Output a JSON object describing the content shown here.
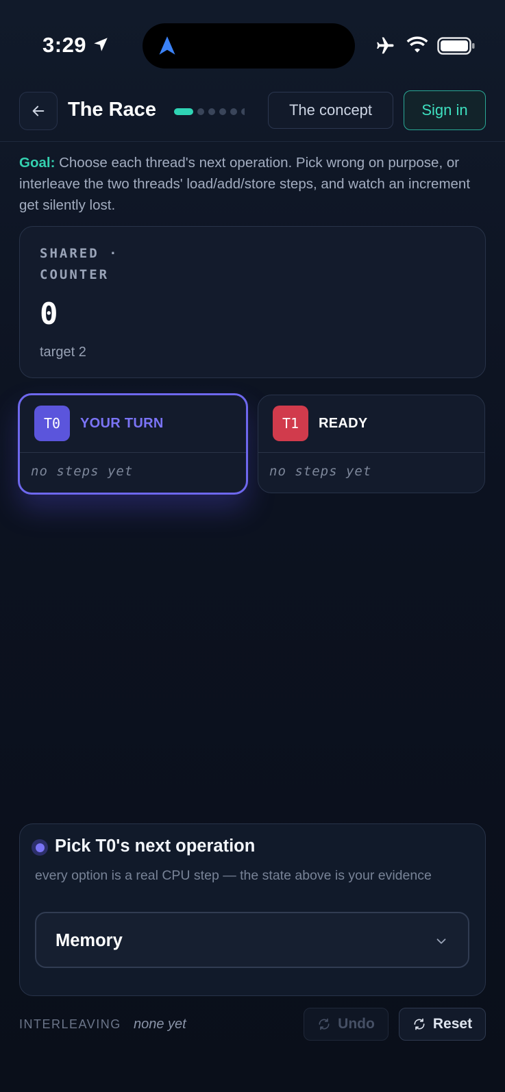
{
  "status_bar": {
    "time": "3:29",
    "icons": [
      "location-arrow-icon",
      "navigation-icon",
      "airplane-icon",
      "wifi-icon",
      "battery-icon"
    ]
  },
  "header": {
    "title": "The Race",
    "concept_label": "The concept",
    "signin_label": "Sign in",
    "progress_step": 1,
    "progress_total": 6
  },
  "goal": {
    "label": "Goal:",
    "text": " Choose each thread's next operation. Pick wrong on purpose, or interleave the two threads' load/add/store steps, and watch an increment get silently lost."
  },
  "counter": {
    "label": "SHARED · COUNTER",
    "value": "0",
    "target": "target 2"
  },
  "threads": [
    {
      "id": "T0",
      "status": "YOUR TURN",
      "steps": "no steps yet",
      "color": "#5b55dc",
      "status_color": "#7b74f6"
    },
    {
      "id": "T1",
      "status": "READY",
      "steps": "no steps yet",
      "color": "#d13b4c",
      "status_color": "#ffffff"
    }
  ],
  "picker": {
    "title": "Pick T0's next operation",
    "subtitle": "every option is a real CPU step — the state above is your evidence",
    "selected": "Memory"
  },
  "footer": {
    "interleaving_label": "INTERLEAVING",
    "interleaving_value": "none yet",
    "undo_label": "Undo",
    "reset_label": "Reset"
  },
  "colors": {
    "accent_teal": "#2fd3b4",
    "accent_purple": "#6e68ee",
    "background": "#0d1422"
  }
}
